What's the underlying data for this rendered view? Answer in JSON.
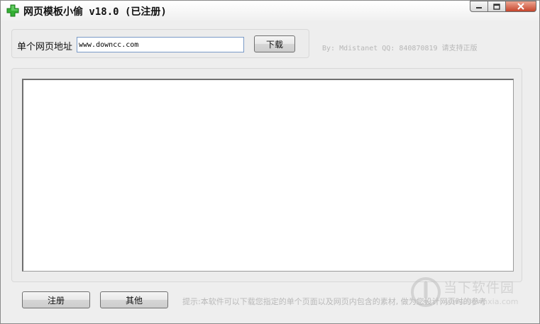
{
  "window": {
    "title": "网页模板小偷 v18.0 (已注册)",
    "icon": "green-plus-icon",
    "controls": {
      "minimize": "minimize-icon",
      "maximize": "maximize-icon",
      "close": "close-icon"
    }
  },
  "url_bar": {
    "label": "单个网页地址",
    "value": "www.downcc.com",
    "download_label": "下载"
  },
  "credit": "By: Mdistanet QQ: 840870819 请支持正版",
  "log": {
    "content": ""
  },
  "footer": {
    "register_label": "注册",
    "other_label": "其他",
    "hint": "提示:本软件可以下载您指定的单个页面以及网页内包含的素材, 做为您设计网页时的参考"
  },
  "watermark": {
    "text": "当下软件园",
    "url": "www.downxia.com"
  },
  "colors": {
    "title_icon": "#2fa52f",
    "close_button": "#c6452c",
    "input_border": "#7a9ac7"
  }
}
